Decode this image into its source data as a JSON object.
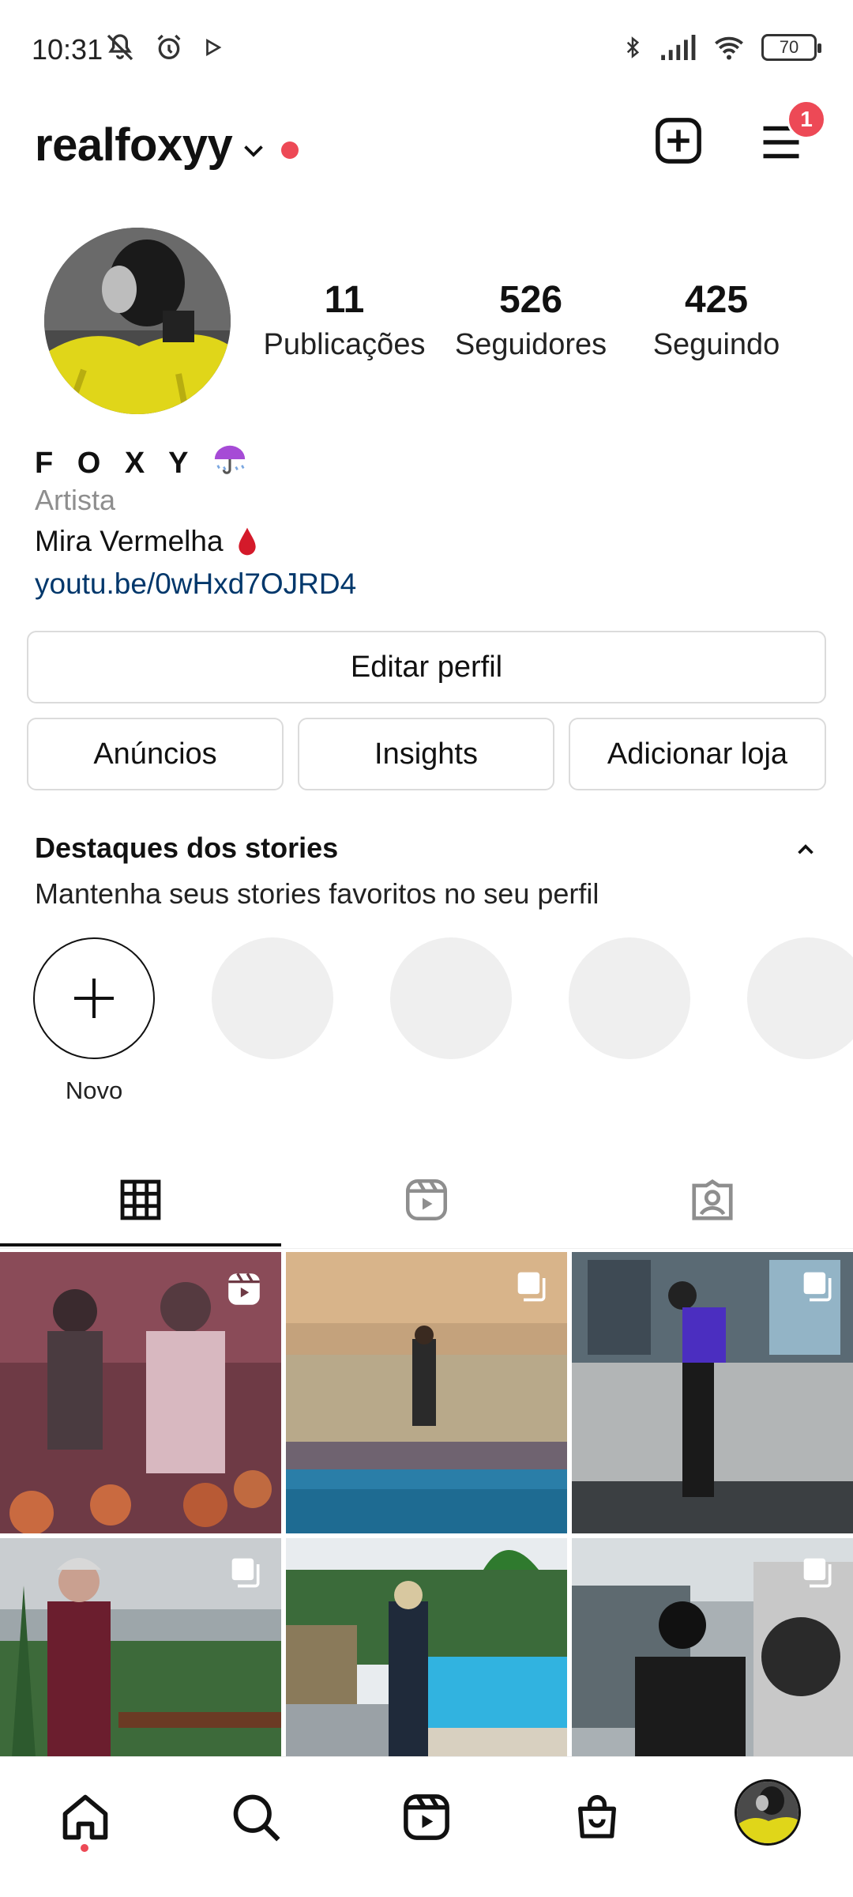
{
  "status_bar": {
    "time": "10:31",
    "battery": "70",
    "icons": [
      "mute-icon",
      "alarm-icon",
      "play-icon",
      "bluetooth-icon",
      "signal-icon",
      "wifi-icon",
      "battery-icon"
    ]
  },
  "header": {
    "username": "realfoxyy",
    "notification_count": "1"
  },
  "profile": {
    "stats": [
      {
        "value": "11",
        "label": "Publicações"
      },
      {
        "value": "526",
        "label": "Seguidores"
      },
      {
        "value": "425",
        "label": "Seguindo"
      }
    ],
    "display_name": "F O X Y",
    "display_name_emoji": "umbrella-icon",
    "category": "Artista",
    "bio": "Mira Vermelha",
    "bio_emoji": "drop-icon",
    "link": "youtu.be/0wHxd7OJRD4"
  },
  "buttons": {
    "edit": "Editar perfil",
    "ads": "Anúncios",
    "insights": "Insights",
    "shop": "Adicionar loja"
  },
  "highlights": {
    "title": "Destaques dos stories",
    "subtitle": "Mantenha seus stories favoritos no seu perfil",
    "new_label": "Novo"
  },
  "tabs": [
    "grid-icon",
    "reels-icon",
    "tagged-icon"
  ],
  "posts": [
    {
      "type": "reel",
      "desc": "party"
    },
    {
      "type": "carousel",
      "desc": "rooftop pool"
    },
    {
      "type": "carousel",
      "desc": "building"
    },
    {
      "type": "carousel",
      "desc": "lake"
    },
    {
      "type": "none",
      "desc": "pool car"
    },
    {
      "type": "carousel",
      "desc": "car park"
    }
  ],
  "bottom_nav": [
    "home-icon",
    "search-icon",
    "reels-icon",
    "shop-icon",
    "profile-avatar"
  ],
  "colors": {
    "accent_red": "#ed4956",
    "link": "#00376b",
    "muted": "#8e8e8e",
    "border": "#dbdbdb"
  }
}
